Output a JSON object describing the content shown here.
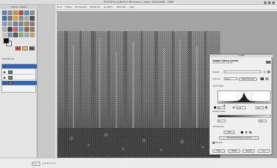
{
  "window": {
    "title": "P1010370-1-HR-P4.0 (Rimouski, 1 layer) 5472x3648 – GIMP"
  },
  "toolbox": {
    "title": "Toolbox - Layers",
    "mode_label": "Mode  Normal"
  },
  "menubar": {
    "items": [
      "Tools",
      "Filters",
      "FX-Foundry",
      "Python-Fu",
      "Script-Fu",
      "Windows",
      "Help"
    ]
  },
  "levels": {
    "window_title": "Levels",
    "heading": "Adjust Colour Levels",
    "subtitle": "4-0 (P1010370-1-HR-P4)",
    "presets_label": "Presets:",
    "channel_label": "Channel:",
    "channel_value": "Value",
    "reset_channel": "Reset Channel",
    "input_levels_label": "Input Levels",
    "input_low": "60",
    "input_gamma": "1.00",
    "input_high": "175",
    "output_levels_label": "Output Levels",
    "output_low": "0",
    "output_high": "255",
    "all_channels_label": "All Channels",
    "auto_button": "Auto",
    "edit_curves_button": "Edit these Settings as Curves",
    "preview_label": "Preview",
    "buttons": {
      "help": "Help",
      "reset": "Reset",
      "cancel": "Cancel",
      "ok": "OK"
    }
  },
  "statusbar": {
    "zoom": "18.2 %",
    "info": "4 (2.21 5 x 5)"
  },
  "colors": {
    "selection": "#2f63b5",
    "canvas_bg": "#a3a3a3"
  }
}
